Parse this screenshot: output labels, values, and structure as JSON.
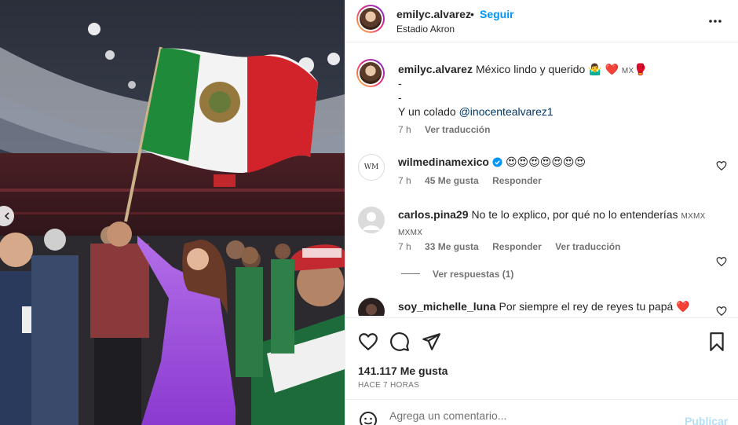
{
  "post": {
    "username": "emilyc.alvarez",
    "dot": "•",
    "follow_label": "Seguir",
    "location": "Estadio Akron"
  },
  "caption": {
    "username": "emilyc.alvarez",
    "text": "México lindo y querido 🤷‍♂️ ❤️",
    "flag": "MX",
    "glove": "🥊",
    "line2": "-",
    "line3": "-",
    "line4_prefix": "Y un colado",
    "mention": "@inocentealvarez1",
    "time": "7 h",
    "translate": "Ver traducción"
  },
  "comments": [
    {
      "username": "wilmedinamexico",
      "text": "😍😍😍😍😍😍😍",
      "time": "7 h",
      "likes": "45 Me gusta",
      "reply": "Responder",
      "avatar_text": "WM"
    },
    {
      "username": "carlos.pina29",
      "text": "No te lo explico, por qué no lo entenderías",
      "flags": "MXMX MXMX",
      "time": "7 h",
      "likes": "33 Me gusta",
      "reply": "Responder",
      "translate": "Ver traducción",
      "view_replies": "Ver respuestas (1)"
    },
    {
      "username": "soy_michelle_luna",
      "text": "Por siempre el rey de reyes tu papá ❤️"
    }
  ],
  "engagement": {
    "likes": "141.117 Me gusta",
    "time_ago": "HACE 7 HORAS"
  },
  "composer": {
    "placeholder": "Agrega un comentario...",
    "publish_label": "Publicar"
  },
  "icons": {
    "more": "more-horizontal-icon",
    "like": "heart-icon",
    "comment": "comment-icon",
    "share": "send-icon",
    "save": "bookmark-icon",
    "emoji": "emoji-icon",
    "prev": "chevron-left-icon"
  },
  "colors": {
    "accent": "#0095f6",
    "mention": "#00376b",
    "verified": "#0095f6",
    "publish_disabled": "#b2dffc",
    "heart_red": "#ed4956"
  }
}
